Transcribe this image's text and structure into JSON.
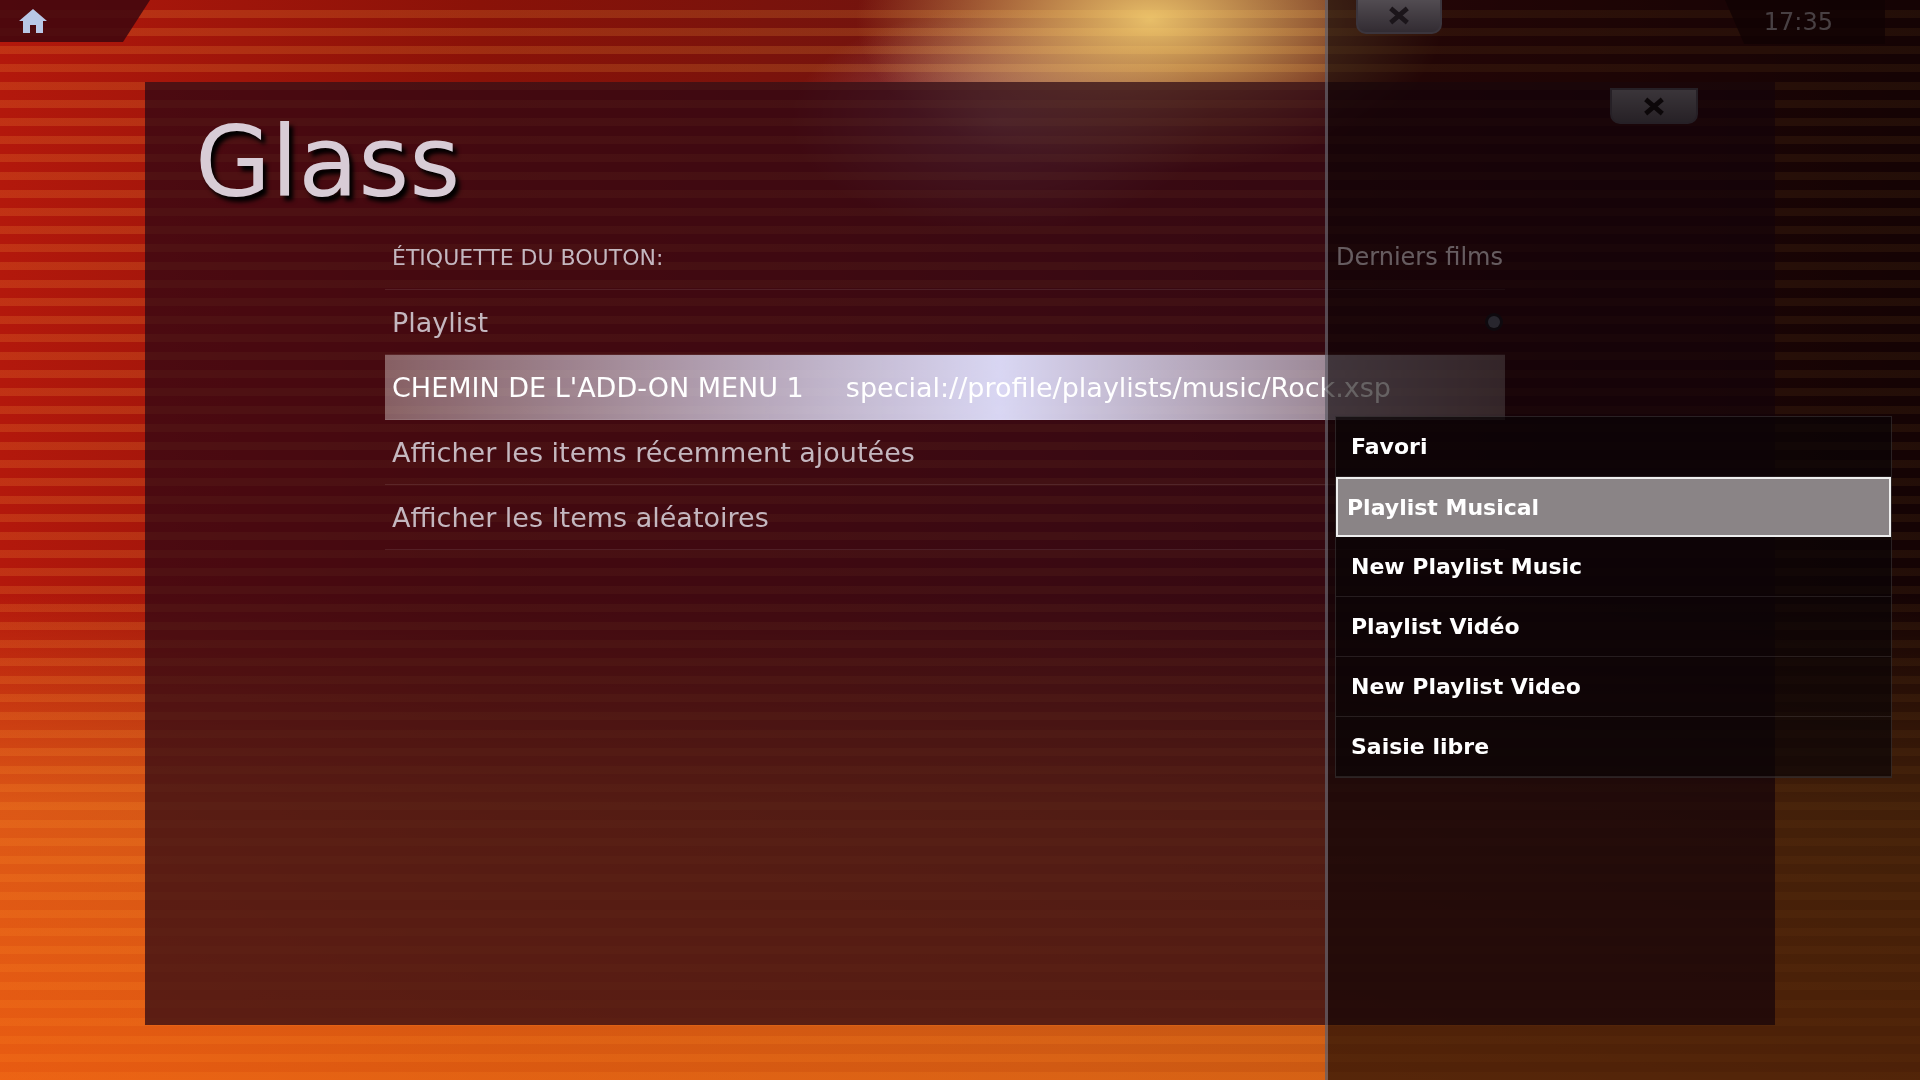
{
  "clock": "17:35",
  "dialog": {
    "title": "Glass",
    "settings": [
      {
        "kind": "header",
        "label": "ÉTIQUETTE DU BOUTON:",
        "value": "Derniers films",
        "selected": false
      },
      {
        "kind": "radio",
        "label": "Playlist",
        "selected": false
      },
      {
        "kind": "path",
        "label": "CHEMIN DE L'ADD-ON MENU 1",
        "value": "special://profile/playlists/music/Rock.xsp",
        "selected": true
      },
      {
        "kind": "option",
        "label": "Afficher les items récemment ajoutées",
        "selected": false
      },
      {
        "kind": "option",
        "label": "Afficher les Items aléatoires",
        "selected": false
      }
    ]
  },
  "popup": {
    "items": [
      {
        "label": "Favori",
        "selected": false
      },
      {
        "label": "Playlist Musical",
        "selected": true
      },
      {
        "label": "New Playlist Music",
        "selected": false
      },
      {
        "label": "Playlist Vidéo",
        "selected": false
      },
      {
        "label": "New Playlist Video",
        "selected": false
      },
      {
        "label": "Saisie libre",
        "selected": false
      }
    ]
  }
}
